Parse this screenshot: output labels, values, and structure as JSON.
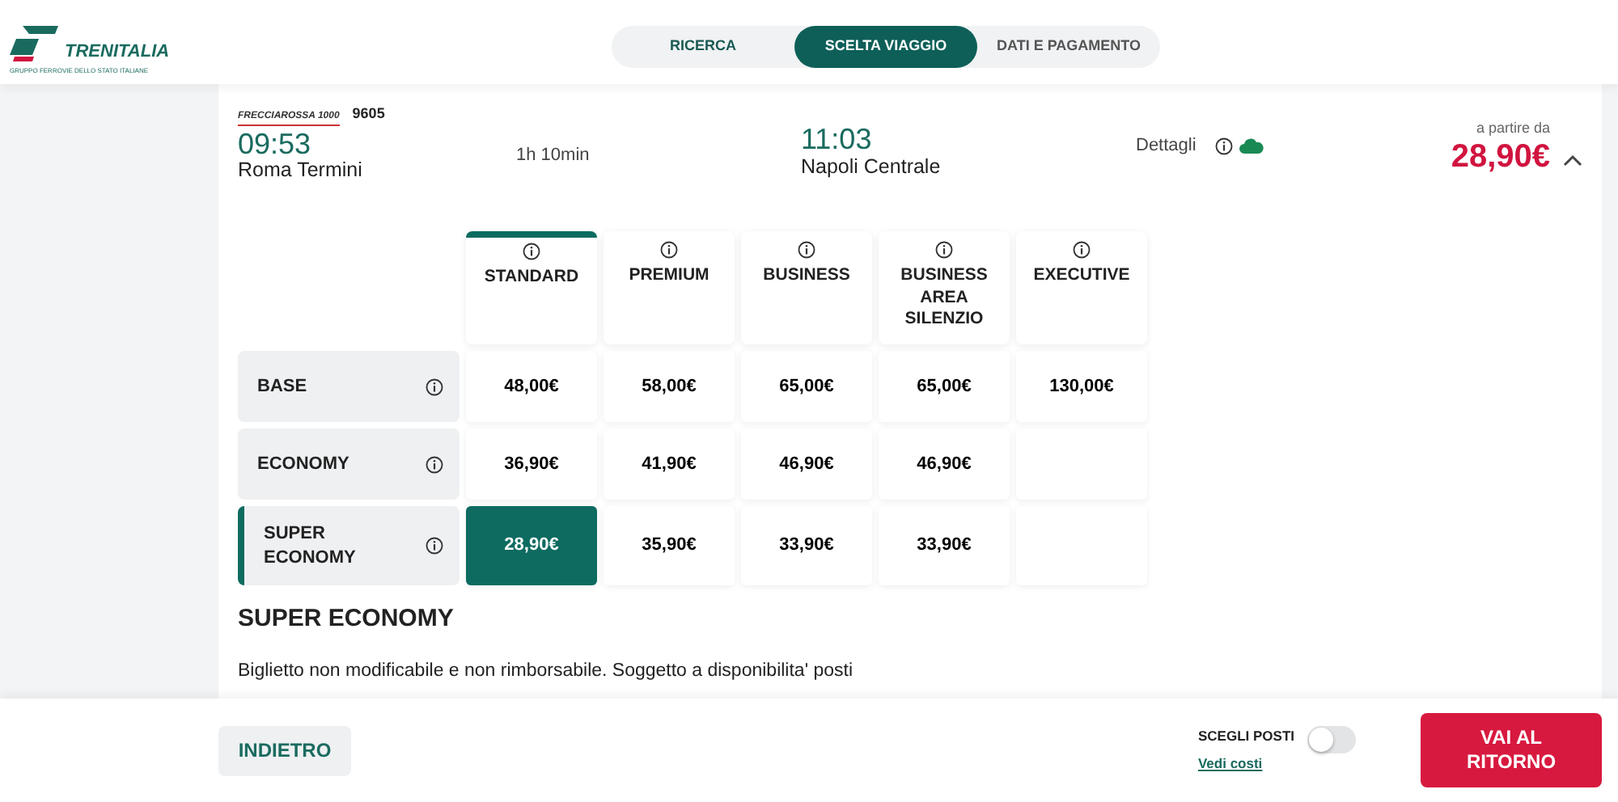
{
  "brand": {
    "name": "TRENITALIA",
    "tagline": "GRUPPO FERROVIE DELLO STATO ITALIANE"
  },
  "steps": [
    {
      "label": "RICERCA",
      "selected": false
    },
    {
      "label": "SCELTA VIAGGIO",
      "selected": true
    },
    {
      "label": "DATI E PAGAMENTO",
      "selected": false
    }
  ],
  "train": {
    "service": "FRECCIAROSSA 1000",
    "number": "9605",
    "departure_time": "09:53",
    "departure_station": "Roma Termini",
    "duration": "1h 10min",
    "arrival_time": "11:03",
    "arrival_station": "Napoli Centrale",
    "details": "Dettagli",
    "price_prefix": "a partire da",
    "price": "28,90€",
    "expanded": true
  },
  "fare_table": {
    "columns": [
      {
        "label": "STANDARD",
        "selected": true
      },
      {
        "label": "PREMIUM",
        "selected": false
      },
      {
        "label": "BUSINESS",
        "selected": false
      },
      {
        "label": "BUSINESS AREA SILENZIO",
        "selected": false
      },
      {
        "label": "EXECUTIVE",
        "selected": false
      }
    ],
    "rows": [
      {
        "label": "BASE",
        "selected": false,
        "cells": [
          {
            "price": "48,00€",
            "selected": false
          },
          {
            "price": "58,00€",
            "selected": false
          },
          {
            "price": "65,00€",
            "selected": false
          },
          {
            "price": "65,00€",
            "selected": false
          },
          {
            "price": "130,00€",
            "selected": false
          }
        ]
      },
      {
        "label": "ECONOMY",
        "selected": false,
        "cells": [
          {
            "price": "36,90€",
            "selected": false
          },
          {
            "price": "41,90€",
            "selected": false
          },
          {
            "price": "46,90€",
            "selected": false
          },
          {
            "price": "46,90€",
            "selected": false
          },
          {
            "selected": false
          }
        ]
      },
      {
        "label": "SUPER ECONOMY",
        "selected": true,
        "cells": [
          {
            "price": "28,90€",
            "selected": true
          },
          {
            "price": "35,90€",
            "selected": false
          },
          {
            "price": "33,90€",
            "selected": false
          },
          {
            "price": "33,90€",
            "selected": false
          },
          {
            "selected": false
          }
        ]
      }
    ]
  },
  "fare_info": {
    "title": "SUPER ECONOMY",
    "description": "Biglietto non modificabile e non rimborsabile. Soggetto a disponibilita' posti"
  },
  "footer": {
    "back_button": "INDIETRO",
    "seat_label": "SCEGLI POSTI",
    "seat_toggle_on": false,
    "seat_link": "Vedi costi",
    "next_button": "VAI AL RITORNO"
  }
}
